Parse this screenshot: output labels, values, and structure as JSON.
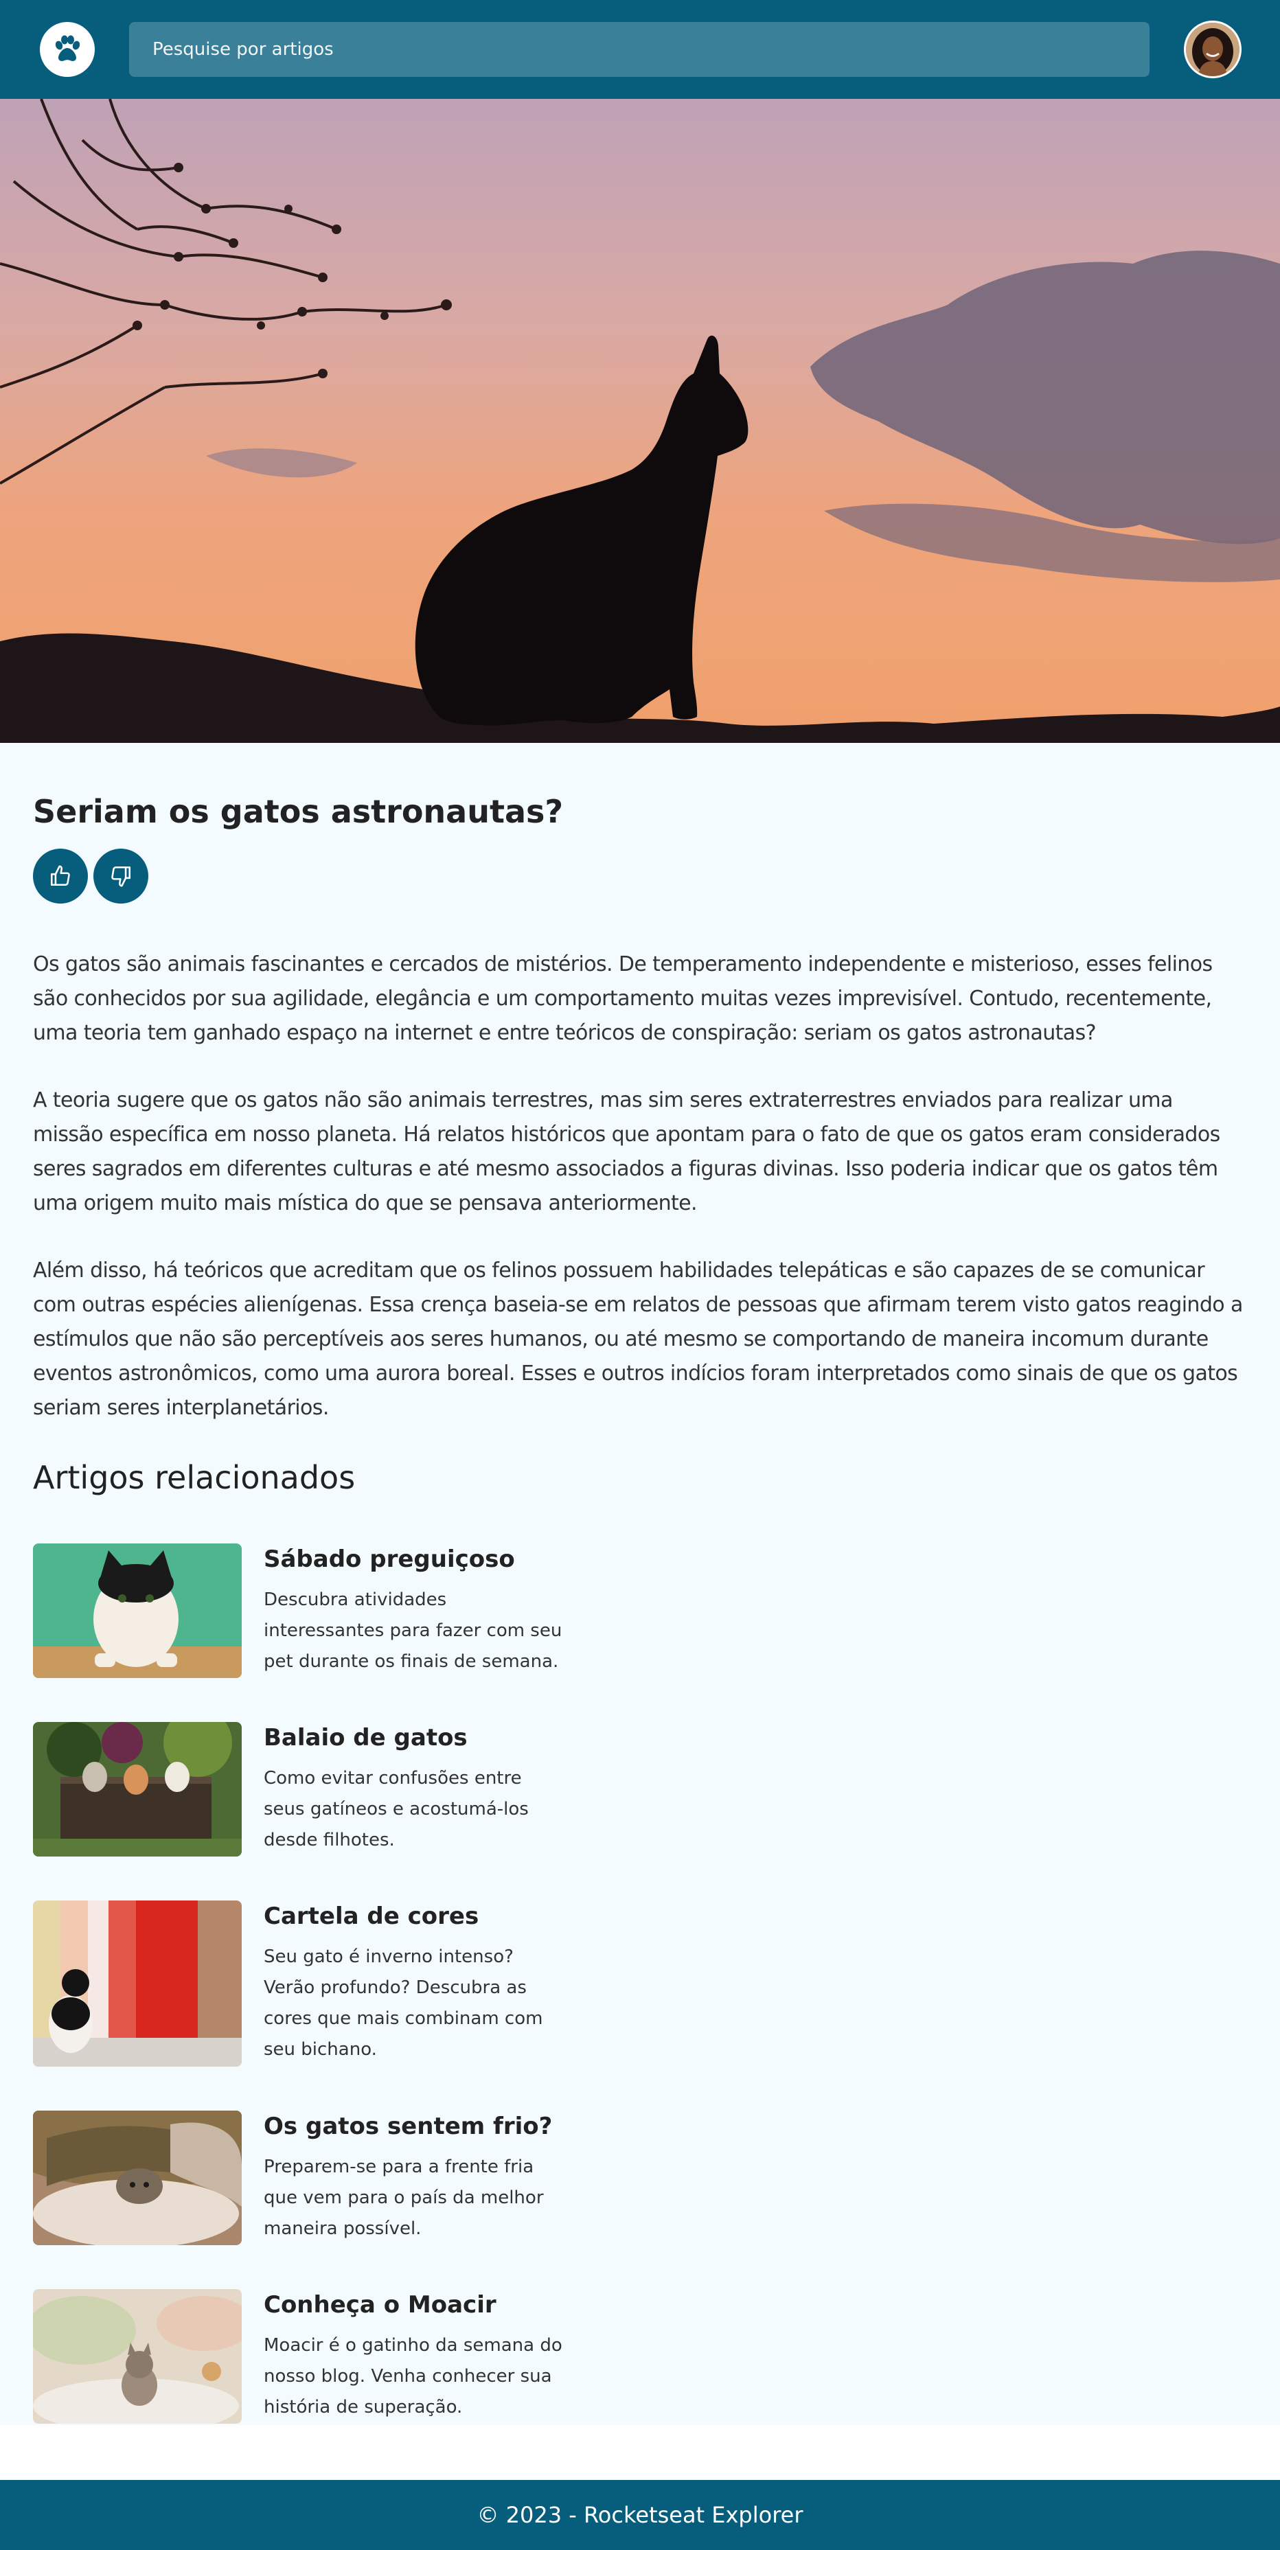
{
  "header": {
    "search_placeholder": "Pesquise por artigos",
    "logo_icon": "paw-icon",
    "avatar_icon": "user-avatar"
  },
  "article": {
    "title": "Seriam os gatos astronautas?",
    "like_icon": "thumbs-up-icon",
    "dislike_icon": "thumbs-down-icon",
    "paragraphs": [
      "Os gatos são animais fascinantes e cercados de mistérios. De temperamento independente e misterioso, esses felinos são conhecidos por sua agilidade, elegância e um comportamento muitas vezes imprevisível. Contudo, recentemente, uma teoria tem ganhado espaço na internet e entre teóricos de conspiração: seriam os gatos astronautas?",
      "A teoria sugere que os gatos não são animais terrestres, mas sim seres extraterrestres enviados para realizar uma missão específica em nosso planeta. Há relatos históricos que apontam para o fato de que os gatos eram considerados seres sagrados em diferentes culturas e até mesmo associados a figuras divinas. Isso poderia indicar que os gatos têm uma origem muito mais mística do que se pensava anteriormente.",
      "Além disso, há teóricos que acreditam que os felinos possuem habilidades telepáticas e são capazes de se comunicar com outras espécies alienígenas. Essa crença baseia-se em relatos de pessoas que afirmam terem visto gatos reagindo a estímulos que não são perceptíveis aos seres humanos, ou até mesmo se comportando de maneira incomum durante eventos astronômicos, como uma aurora boreal. Esses e outros indícios foram interpretados como sinais de que os gatos seriam seres interplanetários."
    ]
  },
  "related": {
    "title": "Artigos relacionados",
    "items": [
      {
        "title": "Sábado preguiçoso",
        "description": "Descubra atividades interessantes para fazer com seu pet durante os finais de semana."
      },
      {
        "title": "Balaio de gatos",
        "description": "Como evitar confusões entre seus gatíneos e acostumá-los desde filhotes."
      },
      {
        "title": "Cartela de cores",
        "description": "Seu gato é inverno intenso? Verão profundo? Descubra as cores que mais combinam com seu bichano."
      },
      {
        "title": "Os gatos sentem frio?",
        "description": "Preparem-se para a frente fria que vem para o país da melhor maneira possível."
      },
      {
        "title": "Conheça o Moacir",
        "description": "Moacir é o gatinho da semana do nosso blog. Venha conhecer sua história de superação."
      }
    ]
  },
  "footer": {
    "text": "© 2023 - Rocketseat Explorer"
  },
  "colors": {
    "primary": "#065e7c",
    "search_bg": "#3a8099",
    "content_bg": "#f3fbfe"
  }
}
